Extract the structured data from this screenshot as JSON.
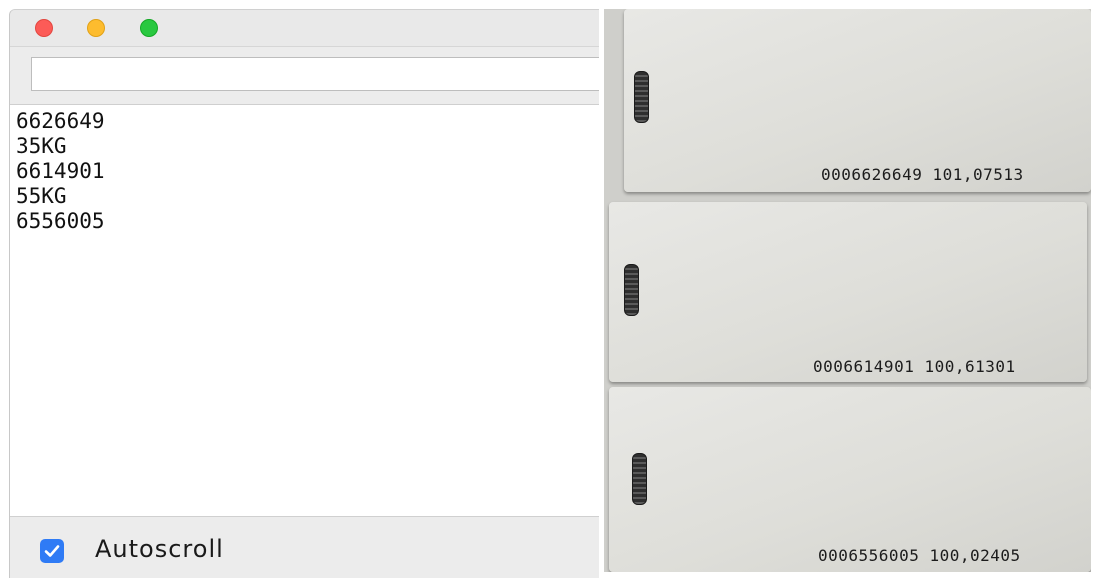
{
  "serial_monitor": {
    "send_input": {
      "value": "",
      "placeholder": ""
    },
    "output_lines": [
      "6626649",
      "35KG",
      "6614901",
      "55KG",
      "6556005"
    ],
    "autoscroll": {
      "label": "Autoscroll",
      "checked": true
    },
    "colors": {
      "close": "#fc5b57",
      "minimize": "#fdbc2e",
      "zoom": "#29c840",
      "checkbox": "#2f7bf5"
    }
  },
  "rfid_cards": [
    {
      "number": "0006626649 101,07513"
    },
    {
      "number": "0006614901 100,61301"
    },
    {
      "number": "0006556005 100,02405"
    }
  ]
}
